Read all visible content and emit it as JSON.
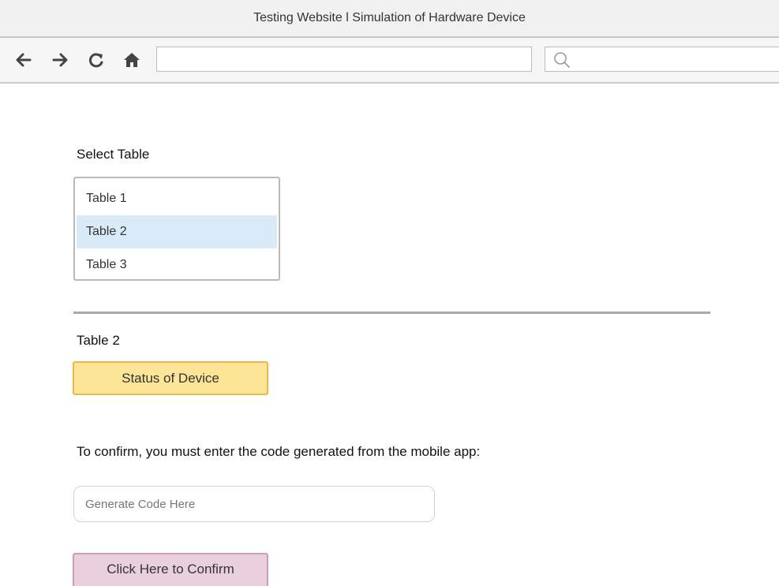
{
  "window": {
    "title": "Testing Website l Simulation of Hardware Device"
  },
  "toolbar": {
    "back_icon": "back-arrow-icon",
    "forward_icon": "forward-arrow-icon",
    "reload_icon": "reload-icon",
    "home_icon": "home-icon",
    "url_value": "",
    "search_value": "",
    "search_icon": "magnifier-icon"
  },
  "main": {
    "select_label": "Select Table",
    "table_list": {
      "items": [
        "Table 1",
        "Table 2",
        "Table 3"
      ],
      "selected": "Table 2"
    },
    "selected_table_heading": "Table 2",
    "status_button_label": "Status of Device",
    "confirm_instruction": "To confirm, you must enter the code generated from the mobile app:",
    "code_input": {
      "value": "",
      "placeholder": "Generate Code Here"
    },
    "confirm_button_label": "Click Here to Confirm"
  },
  "colors": {
    "selected_row": "#d9ebf8",
    "status_button_fill": "#fde598",
    "status_button_border": "#e8b84a",
    "confirm_button_fill": "#ead0dd",
    "confirm_button_border": "#cc9fb9"
  }
}
